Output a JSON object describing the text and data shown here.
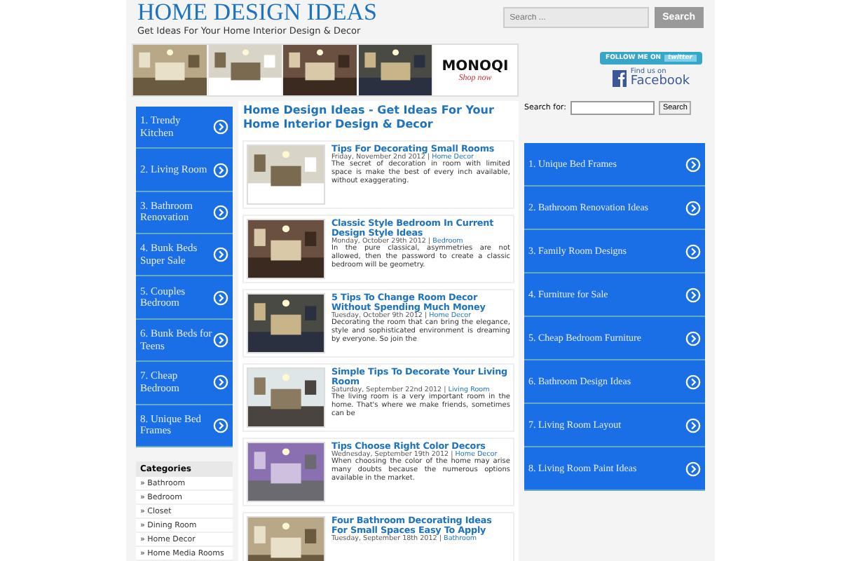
{
  "header": {
    "title": "HOME DESIGN IDEAS",
    "tagline": "Get Ideas For Your Home Interior Design & Decor",
    "search": {
      "placeholder": "Search ...",
      "button": "Search"
    }
  },
  "banner": {
    "brand": "MONOQI",
    "cta": "Shop now"
  },
  "social": {
    "twitter_prefix": "FOLLOW ME ON",
    "twitter": "twitter",
    "facebook_prefix": "Find us on",
    "facebook": "Facebook"
  },
  "left_ads": [
    "1. Trendy Kitchen",
    "2. Living Room",
    "3. Bathroom Renovation",
    "4. Bunk Beds Super Sale",
    "5. Couples Bedroom",
    "6. Bunk Beds for Teens",
    "7. Cheap Bedroom",
    "8. Unique Bed Frames"
  ],
  "categories": {
    "title": "Categories",
    "items": [
      "» Bathroom",
      "» Bedroom",
      "» Closet",
      "» Dining Room",
      "» Home Decor",
      "» Home Media Rooms"
    ]
  },
  "main": {
    "separator": "|",
    "heading": "Home Design Ideas - Get Ideas For Your Home Interior Design & Decor",
    "posts": [
      {
        "title": "Tips For Decorating Small Rooms",
        "date": "Friday, November 2nd 2012",
        "category": "Home Decor",
        "excerpt": "The secret of decoration in room with limited space is make the best of every inch available, without exaggerating."
      },
      {
        "title": "Classic Style Bedroom In Current Design Style Ideas",
        "date": "Monday, October 29th 2012",
        "category": "Bedroom",
        "excerpt": "In the pure classical, asymmetries are not allowed, then the password to create a classic bedroom will be geometry."
      },
      {
        "title": "5 Tips To Change Room Decor Without Spending Much Money",
        "date": "Tuesday, October 9th 2012",
        "category": "Home Decor",
        "excerpt": "Decorating the room that can bring the elegance, style and  sophisticated environment is dreaming by everyone.  So join the"
      },
      {
        "title": "Simple Tips To Decorate Your Living Room",
        "date": "Saturday, September 22nd 2012",
        "category": "Living Room",
        "excerpt": "The living room is a very important room in the home.  That's where we make friends, sometimes can be"
      },
      {
        "title": "Tips Choose Right Color Decors",
        "date": "Wednesday, September 19th 2012",
        "category": "Home Decor",
        "excerpt": "When choosing the color of the home may arise many doubts because the numerous options available in the market."
      },
      {
        "title": "Four Bathroom Decorating Ideas For Small Spaces Easy To Apply",
        "date": "Tuesday, September 18th 2012",
        "category": "Bathroom"
      }
    ]
  },
  "right": {
    "search_label": "Search for:",
    "search_button": "Search",
    "ads": [
      "1. Unique Bed Frames",
      "2. Bathroom Renovation Ideas",
      "3. Family Room Designs",
      "4. Furniture for Sale",
      "5. Cheap Bedroom Furniture",
      "6. Bathroom Design Ideas",
      "7. Living Room Layout",
      "8. Living Room Paint Ideas"
    ]
  }
}
